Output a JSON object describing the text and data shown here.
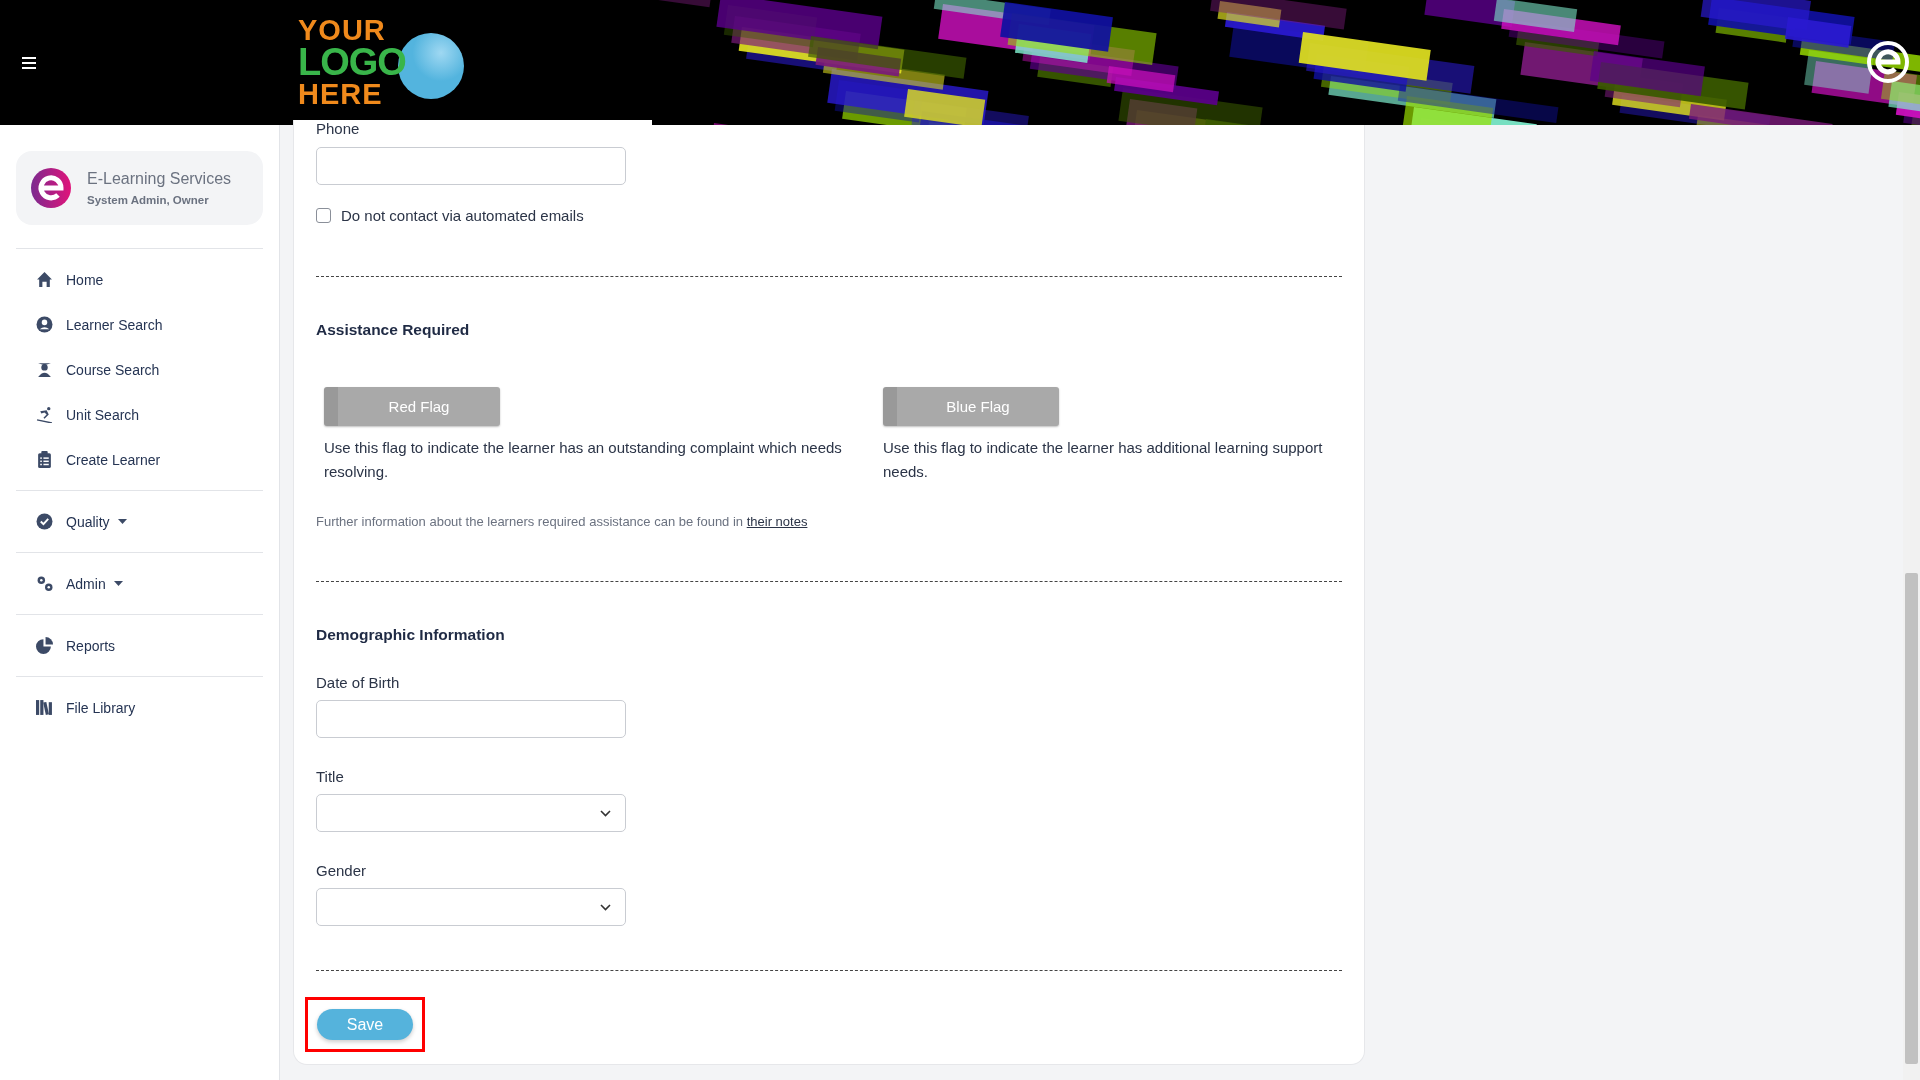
{
  "header": {
    "logo": [
      "YOUR",
      "LOGO",
      "HERE"
    ]
  },
  "sidebar": {
    "profile": {
      "name": "E-Learning Services",
      "role": "System Admin, Owner"
    },
    "groups": [
      [
        {
          "label": "Home"
        },
        {
          "label": "Learner Search"
        },
        {
          "label": "Course Search"
        },
        {
          "label": "Unit Search"
        },
        {
          "label": "Create Learner"
        }
      ],
      [
        {
          "label": "Quality",
          "dropdown": true
        }
      ],
      [
        {
          "label": "Admin",
          "dropdown": true
        }
      ],
      [
        {
          "label": "Reports"
        }
      ],
      [
        {
          "label": "File Library"
        }
      ]
    ]
  },
  "form": {
    "phone": {
      "label": "Phone"
    },
    "no_contact": {
      "label": "Do not contact via automated emails",
      "checked": false
    },
    "assistance": {
      "heading": "Assistance Required",
      "flags": [
        {
          "label": "Red Flag",
          "on": false,
          "description": "Use this flag to indicate the learner has an outstanding complaint which needs resolving."
        },
        {
          "label": "Blue Flag",
          "on": false,
          "description": "Use this flag to indicate the learner has additional learning support needs."
        }
      ],
      "note": "Further information about the learners required assistance can be found in",
      "note_link": "their notes"
    },
    "demographic": {
      "heading": "Demographic Information",
      "fields": [
        {
          "label": "Date of Birth",
          "kind": "text"
        },
        {
          "label": "Title",
          "kind": "select"
        },
        {
          "label": "Gender",
          "kind": "select"
        }
      ]
    },
    "save": {
      "label": "Save",
      "highlighted": true
    }
  }
}
